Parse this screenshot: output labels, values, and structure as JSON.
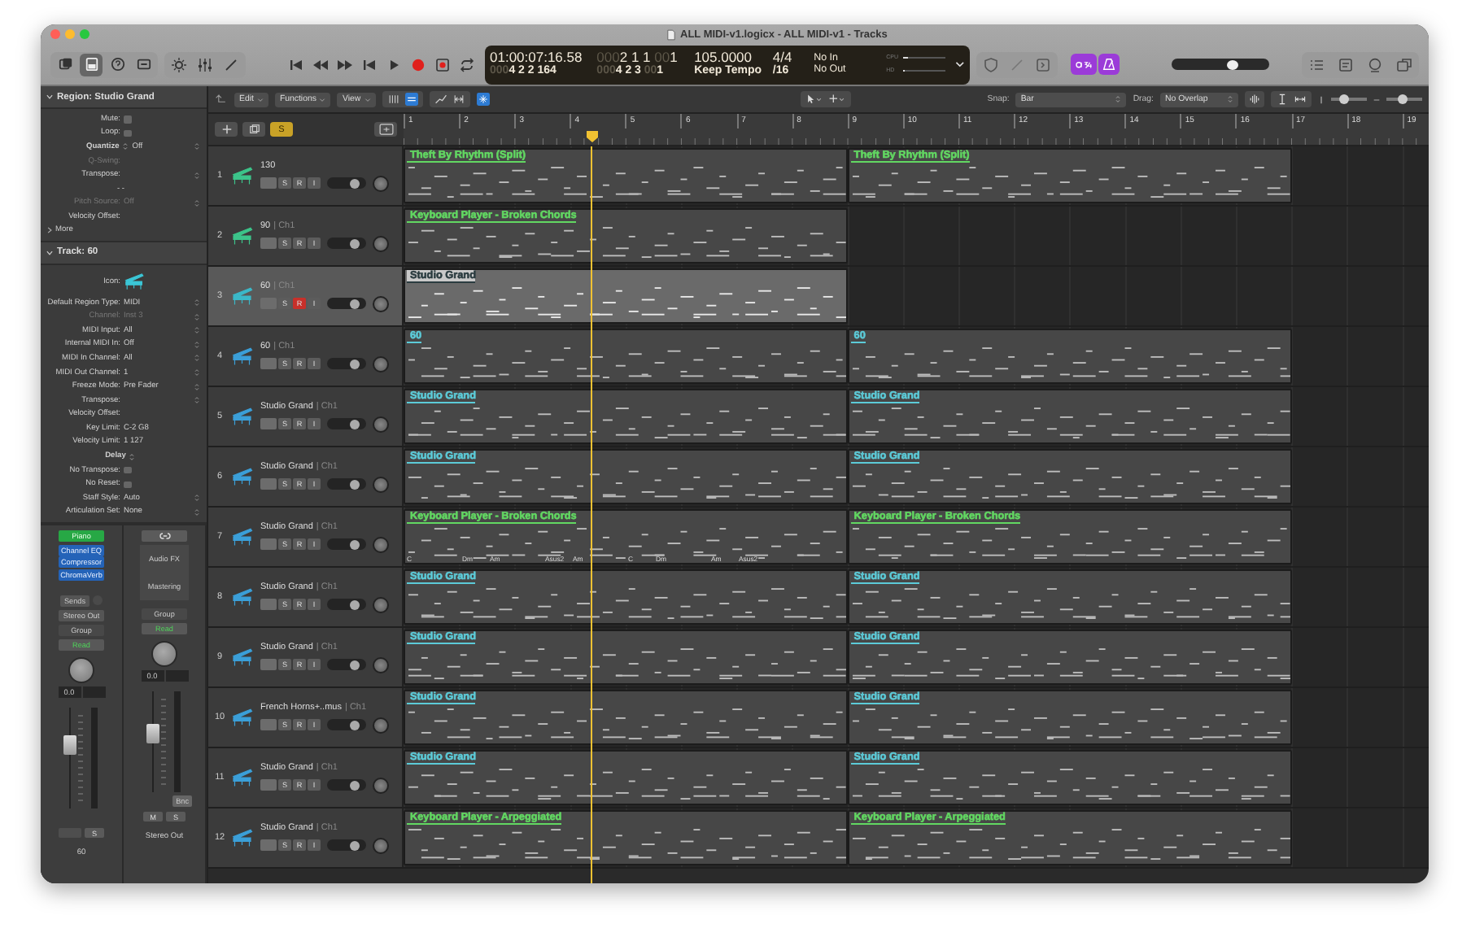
{
  "window": {
    "title": "ALL MIDI-v1.logicx - ALL MIDI-v1 - Tracks"
  },
  "control_bar": {
    "view_buttons": [
      {
        "kind": "library",
        "selected": false
      },
      {
        "kind": "inspector",
        "selected": true
      },
      {
        "kind": "help",
        "selected": false
      },
      {
        "kind": "toolbar",
        "selected": false
      }
    ],
    "lcd": {
      "smpte": "01:00:07:16.58",
      "position": {
        "lead": "000",
        "main": "2 1 1",
        "pad": "00",
        "tick": "1"
      },
      "tempo": "105.0000",
      "signature": "4/4",
      "midi_in": "No In",
      "end_position": {
        "lead": "000",
        "main": "4 2 2 164"
      },
      "locator": {
        "lead": "000",
        "main": "4 2 3",
        "pad": "00",
        "tick": "1"
      },
      "tempo_mode": "Keep Tempo",
      "division": "/16",
      "midi_out": "No Out",
      "meters": [
        {
          "label": "CPU",
          "level": 0.12
        },
        {
          "label": "HD",
          "level": 0.04
        }
      ]
    },
    "mode_buttons": [
      {
        "kind": "count_in",
        "on": true
      },
      {
        "kind": "metronome",
        "on": true
      }
    ],
    "master_volume": {
      "level": 0.62
    }
  },
  "tracks_toolbar": {
    "menus": [
      "Edit",
      "Functions",
      "View"
    ],
    "vertical_zoom": {
      "level": 0.35
    },
    "horizontal_zoom": {
      "level": 0.45
    },
    "catch": {
      "on": true
    },
    "snap": {
      "label": "Snap:",
      "value": "Bar"
    },
    "drag": {
      "label": "Drag:",
      "value": "No Overlap"
    }
  },
  "header_bar": {
    "global_solo": {
      "label": "S",
      "on": true
    }
  },
  "ruler": [
    "1",
    "2",
    "3",
    "4",
    "5",
    "6",
    "7",
    "8",
    "9",
    "10",
    "11",
    "12",
    "13",
    "14",
    "15",
    "16",
    "17",
    "18",
    "19"
  ],
  "inspector": {
    "region": {
      "title": "Region: Studio Grand",
      "expanded": true,
      "more": "More",
      "rows": [
        {
          "kind": "checkbox",
          "label": "Mute:",
          "checked": false
        },
        {
          "kind": "checkbox",
          "label": "Loop:",
          "checked": false
        },
        {
          "kind": "field",
          "label": "Quantize",
          "label_select": true,
          "value": "Off",
          "select": true,
          "disabled": false
        },
        {
          "kind": "field",
          "label": "Q-Swing:",
          "disabled": true
        },
        {
          "kind": "field",
          "label": "Transpose:",
          "select": true,
          "disabled": false
        },
        {
          "kind": "dash",
          "value": "- -"
        },
        {
          "kind": "field",
          "label": "Pitch Source:",
          "value": "Off",
          "select": true,
          "disabled": true
        },
        {
          "kind": "field",
          "label": "Velocity Offset:",
          "disabled": false
        }
      ]
    },
    "track": {
      "title": "Track: 60",
      "expanded": true,
      "rows": [
        {
          "kind": "icon",
          "label": "Icon:"
        },
        {
          "kind": "field",
          "label": "Default Region Type:",
          "value": "MIDI",
          "select": true,
          "disabled": false
        },
        {
          "kind": "field",
          "label": "Channel:",
          "value": "Inst 3",
          "select": true,
          "disabled": true
        },
        {
          "kind": "field",
          "label": "MIDI Input:",
          "value": "All",
          "select": true,
          "disabled": false
        },
        {
          "kind": "field",
          "label": "Internal MIDI In:",
          "value": "Off",
          "select": true,
          "disabled": false
        },
        {
          "kind": "field",
          "label": "MIDI In Channel:",
          "value": "All",
          "select": true,
          "disabled": false
        },
        {
          "kind": "field",
          "label": "MIDI Out Channel:",
          "value": "1",
          "select": true,
          "disabled": false
        },
        {
          "kind": "field",
          "label": "Freeze Mode:",
          "value": "Pre Fader",
          "select": true,
          "disabled": false
        },
        {
          "kind": "field",
          "label": "Transpose:",
          "select": true,
          "disabled": false
        },
        {
          "kind": "field",
          "label": "Velocity Offset:",
          "disabled": false
        },
        {
          "kind": "field",
          "label": "Key Limit:",
          "value": "C-2  G8",
          "disabled": false
        },
        {
          "kind": "field",
          "label": "Velocity Limit:",
          "value": "1  127",
          "disabled": false
        },
        {
          "kind": "menu",
          "label": "Delay"
        },
        {
          "kind": "checkbox",
          "label": "No Transpose:",
          "checked": false
        },
        {
          "kind": "checkbox",
          "label": "No Reset:",
          "checked": false
        },
        {
          "kind": "field",
          "label": "Staff Style:",
          "value": "Auto",
          "select": true,
          "disabled": false
        },
        {
          "kind": "field",
          "label": "Articulation Set:",
          "value": "None",
          "select": true,
          "disabled": false
        }
      ]
    },
    "strips": [
      {
        "kind": "instrument",
        "setting": "Piano",
        "plugins": [
          "Channel EQ",
          "Compressor",
          "ChromaVerb"
        ],
        "sends": "Sends",
        "output": "Stereo Out",
        "group": "Group",
        "automation": "Read",
        "pan": "0.0",
        "level": 0.62,
        "buttons": [
          "S"
        ],
        "name": "60"
      },
      {
        "kind": "output",
        "fx": [
          "Audio FX",
          "Mastering"
        ],
        "group": "Group",
        "automation": "Read",
        "pan": "0.0",
        "level": 0.58,
        "bounce": "Bnc",
        "buttons": [
          "M",
          "S"
        ],
        "name": "Stereo Out"
      }
    ]
  },
  "tracks": [
    {
      "number": "1",
      "name": "130",
      "color": "#3cc48a",
      "selected": false,
      "record": false,
      "buttons": [
        "S",
        "R",
        "I"
      ],
      "level": 0.72,
      "regions": [
        {
          "name": "Theft By Rhythm (Split)",
          "color": "#62d862",
          "selected": false
        },
        {
          "name": "Theft By Rhythm (Split)",
          "color": "#62d862",
          "selected": false
        }
      ]
    },
    {
      "number": "2",
      "name": "90",
      "channel": "| Ch1",
      "color": "#3cc48a",
      "selected": false,
      "record": false,
      "buttons": [
        "S",
        "R",
        "I"
      ],
      "level": 0.72,
      "regions": [
        {
          "name": "Keyboard Player - Broken Chords",
          "color": "#62d862",
          "selected": false
        }
      ]
    },
    {
      "number": "3",
      "name": "60",
      "channel": "| Ch1",
      "color": "#3bb8c8",
      "selected": true,
      "record": true,
      "buttons": [
        "S",
        "R",
        "I"
      ],
      "level": 0.72,
      "regions": [
        {
          "name": "Studio Grand",
          "color": "#2b3c40",
          "selected": true
        }
      ]
    },
    {
      "number": "4",
      "name": "60",
      "channel": "| Ch1",
      "color": "#3b9fd8",
      "selected": false,
      "record": false,
      "buttons": [
        "S",
        "R",
        "I"
      ],
      "level": 0.72,
      "regions": [
        {
          "name": "60",
          "color": "#5ccbd8",
          "selected": false
        },
        {
          "name": "60",
          "color": "#5ccbd8",
          "selected": false
        }
      ]
    },
    {
      "number": "5",
      "name": "Studio Grand",
      "channel": "| Ch1",
      "color": "#3b9fd8",
      "selected": false,
      "record": false,
      "buttons": [
        "S",
        "R",
        "I"
      ],
      "level": 0.72,
      "regions": [
        {
          "name": "Studio Grand",
          "color": "#5ccbd8",
          "selected": false
        },
        {
          "name": "Studio Grand",
          "color": "#5ccbd8",
          "selected": false
        }
      ]
    },
    {
      "number": "6",
      "name": "Studio Grand",
      "channel": "| Ch1",
      "color": "#3b9fd8",
      "selected": false,
      "record": false,
      "buttons": [
        "S",
        "R",
        "I"
      ],
      "level": 0.72,
      "regions": [
        {
          "name": "Studio Grand",
          "color": "#5ccbd8",
          "selected": false
        },
        {
          "name": "Studio Grand",
          "color": "#5ccbd8",
          "selected": false
        }
      ]
    },
    {
      "number": "7",
      "name": "Studio Grand",
      "channel": "| Ch1",
      "color": "#3b9fd8",
      "selected": false,
      "record": false,
      "buttons": [
        "S",
        "R",
        "I"
      ],
      "level": 0.72,
      "regions": [
        {
          "name": "Keyboard Player - Broken Chords",
          "color": "#62d862",
          "selected": false,
          "chords": [
            "C",
            "Dm",
            "Am",
            "Asus2",
            "Am",
            "C",
            "Dm",
            "Am",
            "Asus2"
          ]
        },
        {
          "name": "Keyboard Player - Broken Chords",
          "color": "#62d862",
          "selected": false
        }
      ]
    },
    {
      "number": "8",
      "name": "Studio Grand",
      "channel": "| Ch1",
      "color": "#3b9fd8",
      "selected": false,
      "record": false,
      "buttons": [
        "S",
        "R",
        "I"
      ],
      "level": 0.72,
      "regions": [
        {
          "name": "Studio Grand",
          "color": "#5ccbd8",
          "selected": false
        },
        {
          "name": "Studio Grand",
          "color": "#5ccbd8",
          "selected": false
        }
      ]
    },
    {
      "number": "9",
      "name": "Studio Grand",
      "channel": "| Ch1",
      "color": "#3b9fd8",
      "selected": false,
      "record": false,
      "buttons": [
        "S",
        "R",
        "I"
      ],
      "level": 0.72,
      "regions": [
        {
          "name": "Studio Grand",
          "color": "#5ccbd8",
          "selected": false
        },
        {
          "name": "Studio Grand",
          "color": "#5ccbd8",
          "selected": false
        }
      ]
    },
    {
      "number": "10",
      "name": "French Horns+..mus",
      "channel": "| Ch1",
      "color": "#3b9fd8",
      "selected": false,
      "record": false,
      "buttons": [
        "S",
        "R",
        "I"
      ],
      "level": 0.72,
      "regions": [
        {
          "name": "Studio Grand",
          "color": "#5ccbd8",
          "selected": false
        },
        {
          "name": "Studio Grand",
          "color": "#5ccbd8",
          "selected": false
        }
      ]
    },
    {
      "number": "11",
      "name": "Studio Grand",
      "channel": "| Ch1",
      "color": "#3b9fd8",
      "selected": false,
      "record": false,
      "buttons": [
        "S",
        "R",
        "I"
      ],
      "level": 0.72,
      "regions": [
        {
          "name": "Studio Grand",
          "color": "#5ccbd8",
          "selected": false
        },
        {
          "name": "Studio Grand",
          "color": "#5ccbd8",
          "selected": false
        }
      ]
    },
    {
      "number": "12",
      "name": "Studio Grand",
      "channel": "| Ch1",
      "color": "#3b9fd8",
      "selected": false,
      "record": false,
      "buttons": [
        "S",
        "R",
        "I"
      ],
      "level": 0.72,
      "regions": [
        {
          "name": "Keyboard Player - Arpeggiated",
          "color": "#62d862",
          "selected": false
        },
        {
          "name": "Keyboard Player - Arpeggiated",
          "color": "#62d862",
          "selected": false
        }
      ]
    }
  ]
}
